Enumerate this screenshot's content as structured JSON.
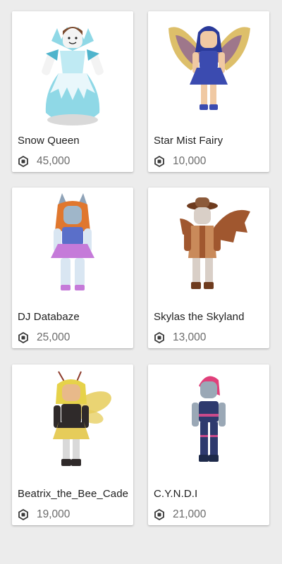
{
  "items": [
    {
      "name": "Snow Queen",
      "price": "45,000",
      "currency_icon": "robux-icon",
      "colors": {
        "primary": "#8fd8e6",
        "secondary": "#e9f7fb",
        "accent": "#4fb4cc",
        "hair": "#7a4a2e",
        "skin": "#f3f3f3"
      }
    },
    {
      "name": "Star Mist Fairy",
      "price": "10,000",
      "currency_icon": "robux-icon",
      "colors": {
        "primary": "#3b4bb0",
        "secondary": "#d9b85a",
        "accent": "#6a3ca6",
        "hair": "#2a3a9a",
        "skin": "#f0c9a3"
      }
    },
    {
      "name": "DJ Databaze",
      "price": "25,000",
      "currency_icon": "robux-icon",
      "colors": {
        "primary": "#c57ad9",
        "secondary": "#d9e6f2",
        "accent": "#5a6fc9",
        "hair": "#e0772e",
        "skin": "#9fb6c9"
      }
    },
    {
      "name": "Skylas the Skyland",
      "price": "13,000",
      "currency_icon": "robux-icon",
      "colors": {
        "primary": "#a0572f",
        "secondary": "#c98a5a",
        "accent": "#6e3b1e",
        "hair": "#8c5a3a",
        "skin": "#d9cfc7"
      }
    },
    {
      "name": "Beatrix_the_Bee_Cade",
      "price": "19,000",
      "currency_icon": "robux-icon",
      "colors": {
        "primary": "#2f2a2a",
        "secondary": "#e6cc5a",
        "accent": "#8c3a2a",
        "hair": "#e6d24a",
        "skin": "#e8b98a"
      }
    },
    {
      "name": "C.Y.N.D.I",
      "price": "21,000",
      "currency_icon": "robux-icon",
      "colors": {
        "primary": "#2e3a6e",
        "secondary": "#c94a8a",
        "accent": "#1e2a4a",
        "hair": "#e0407a",
        "skin": "#9aa8b6"
      }
    }
  ]
}
